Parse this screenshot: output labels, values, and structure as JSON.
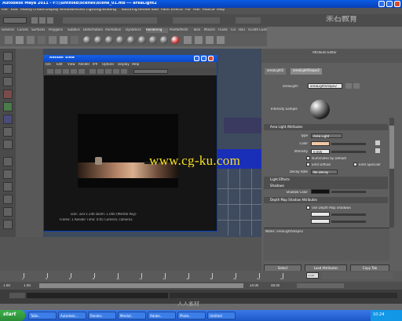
{
  "window": {
    "title": "Autodesk Maya 2011 - F:\\\\\\untitled\\scenes\\scene_01.mb --- areaLight2"
  },
  "menus": [
    "File",
    "Edit",
    "Modify",
    "Create",
    "Display",
    "Window",
    "Assets",
    "Lighting/Shading",
    "Texturing",
    "Render",
    "Toon",
    "Paint Effects",
    "Fur",
    "Hair",
    "Muscle",
    "Help"
  ],
  "shelf": {
    "tabs": [
      "General",
      "Curves",
      "Surfaces",
      "Polygons",
      "Subdivs",
      "Deformation",
      "Animation",
      "Dynamics",
      "Rendering",
      "PaintEffects",
      "Toon",
      "Muscle",
      "Fluids",
      "Fur",
      "Hair",
      "nCloth",
      "Custom"
    ],
    "active_tab": "Rendering"
  },
  "render_view": {
    "title": "Render View",
    "menus": [
      "File",
      "Edit",
      "View",
      "Render",
      "IPR",
      "Options",
      "Display",
      "Help"
    ],
    "status_line1": "size: 320 x 240  zoom: 1.000    (Mental Ray)",
    "status_line2": "Frame: 1    Render Time: 0:05    Camera: camera1"
  },
  "attribute_editor": {
    "header": "Attribute Editor",
    "tabs": [
      "areaLight2",
      "areaLightShape2"
    ],
    "name_label": "areaLight:",
    "name_value": "areaLightShape2",
    "sample_label": "Intensity Sample",
    "sections": {
      "area_light_attrs": "Area Light Attributes",
      "light_effects": "Light Effects",
      "shadows": "Shadows",
      "depth_map": "Depth Map Shadow Attributes"
    },
    "fields": {
      "type_label": "Type",
      "type_value": "Area Light",
      "color_label": "Color",
      "intensity_label": "Intensity",
      "intensity_value": "0.000",
      "illum_default": "Illuminates by Default",
      "emit_diffuse": "Emit Diffuse",
      "emit_specular": "Emit Specular",
      "decay_label": "Decay Rate",
      "decay_value": "No Decay",
      "shadow_color_label": "Shadow Color",
      "depth_map_label": "Use Depth Map Shadows"
    },
    "notes_label": "Notes: areaLightShape2",
    "buttons": [
      "Select",
      "Load Attributes",
      "Copy Tab"
    ],
    "color_swatch": "#f2c9a5",
    "shadow_swatch": "#111111"
  },
  "timeline": {
    "start": "1.00",
    "end": "24.00",
    "range_start": "1.00",
    "range_end": "48.00",
    "current_frame": "1.00",
    "ticks": [
      "2",
      "4",
      "6",
      "8",
      "10",
      "12",
      "14",
      "16",
      "18",
      "20",
      "22",
      "24"
    ]
  },
  "taskbar": {
    "start_label": "start",
    "items": [
      "ToBe..",
      "Autodesk...",
      "Render..",
      "Mental..",
      "Adobe..",
      "Photo..",
      "Untitled"
    ],
    "time": "10:24"
  },
  "watermarks": {
    "main": "www.cg-ku.com",
    "logo": "未石教育",
    "bottom": "人人素材"
  },
  "colors": {
    "accent": "#0a5ce4",
    "watermark": "#f5e020",
    "render_floor": "#d8b090"
  }
}
